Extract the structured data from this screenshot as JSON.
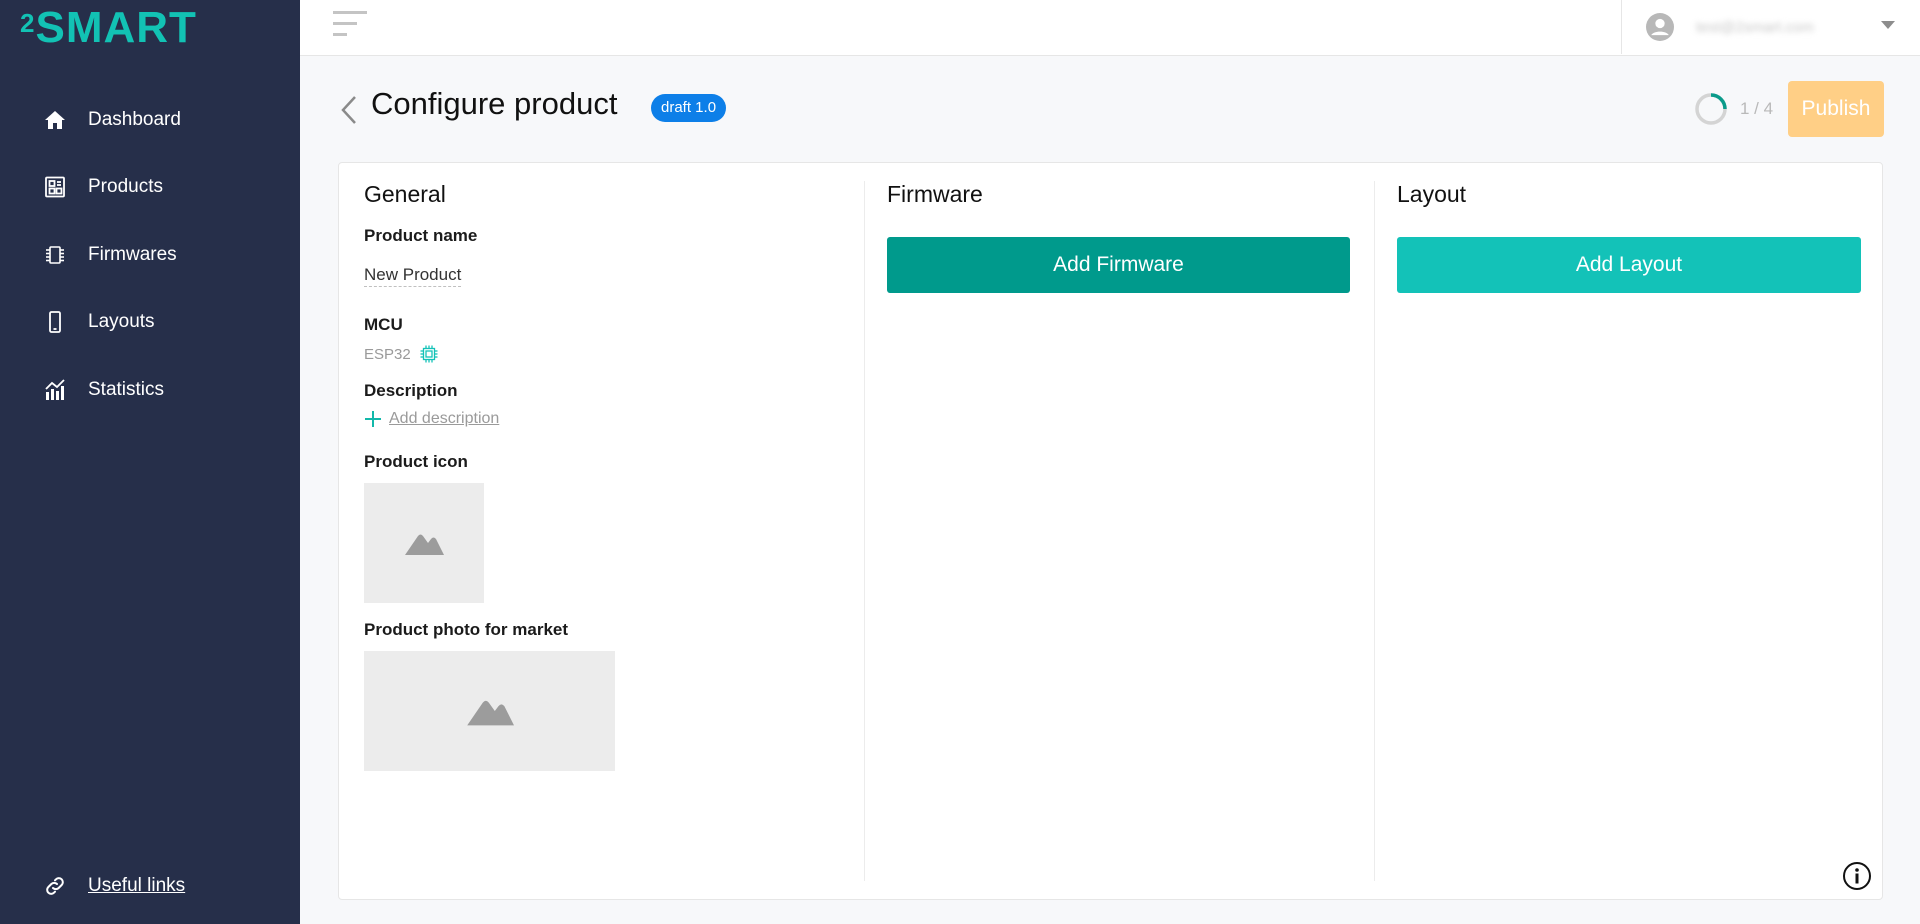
{
  "brand": {
    "logo_sup": "2",
    "logo_word": "SMART",
    "accent": "#12c2b4"
  },
  "sidebar": {
    "items": [
      {
        "label": "Dashboard",
        "icon": "home-icon"
      },
      {
        "label": "Products",
        "icon": "products-icon"
      },
      {
        "label": "Firmwares",
        "icon": "chip-icon"
      },
      {
        "label": "Layouts",
        "icon": "phone-icon"
      },
      {
        "label": "Statistics",
        "icon": "chart-icon"
      }
    ],
    "useful_links": "Useful links"
  },
  "topbar": {
    "user_email": "test@2smart.com"
  },
  "header": {
    "title": "Configure product",
    "badge": "draft 1.0",
    "progress_text": "1 / 4",
    "progress_fraction": 0.25,
    "publish_label": "Publish"
  },
  "general": {
    "heading": "General",
    "product_name_label": "Product name",
    "product_name_value": "New Product",
    "mcu_label": "MCU",
    "mcu_value": "ESP32",
    "description_label": "Description",
    "add_description": "Add description",
    "product_icon_label": "Product icon",
    "product_photo_label": "Product photo for market"
  },
  "firmware": {
    "heading": "Firmware",
    "add_label": "Add Firmware"
  },
  "layout": {
    "heading": "Layout",
    "add_label": "Add Layout"
  },
  "colors": {
    "sidebar_bg": "#262f4a",
    "badge": "#0d7fe8",
    "publish_disabled": "#ffcf86",
    "firmware_btn": "#009a8c",
    "layout_btn": "#13c2b8"
  }
}
